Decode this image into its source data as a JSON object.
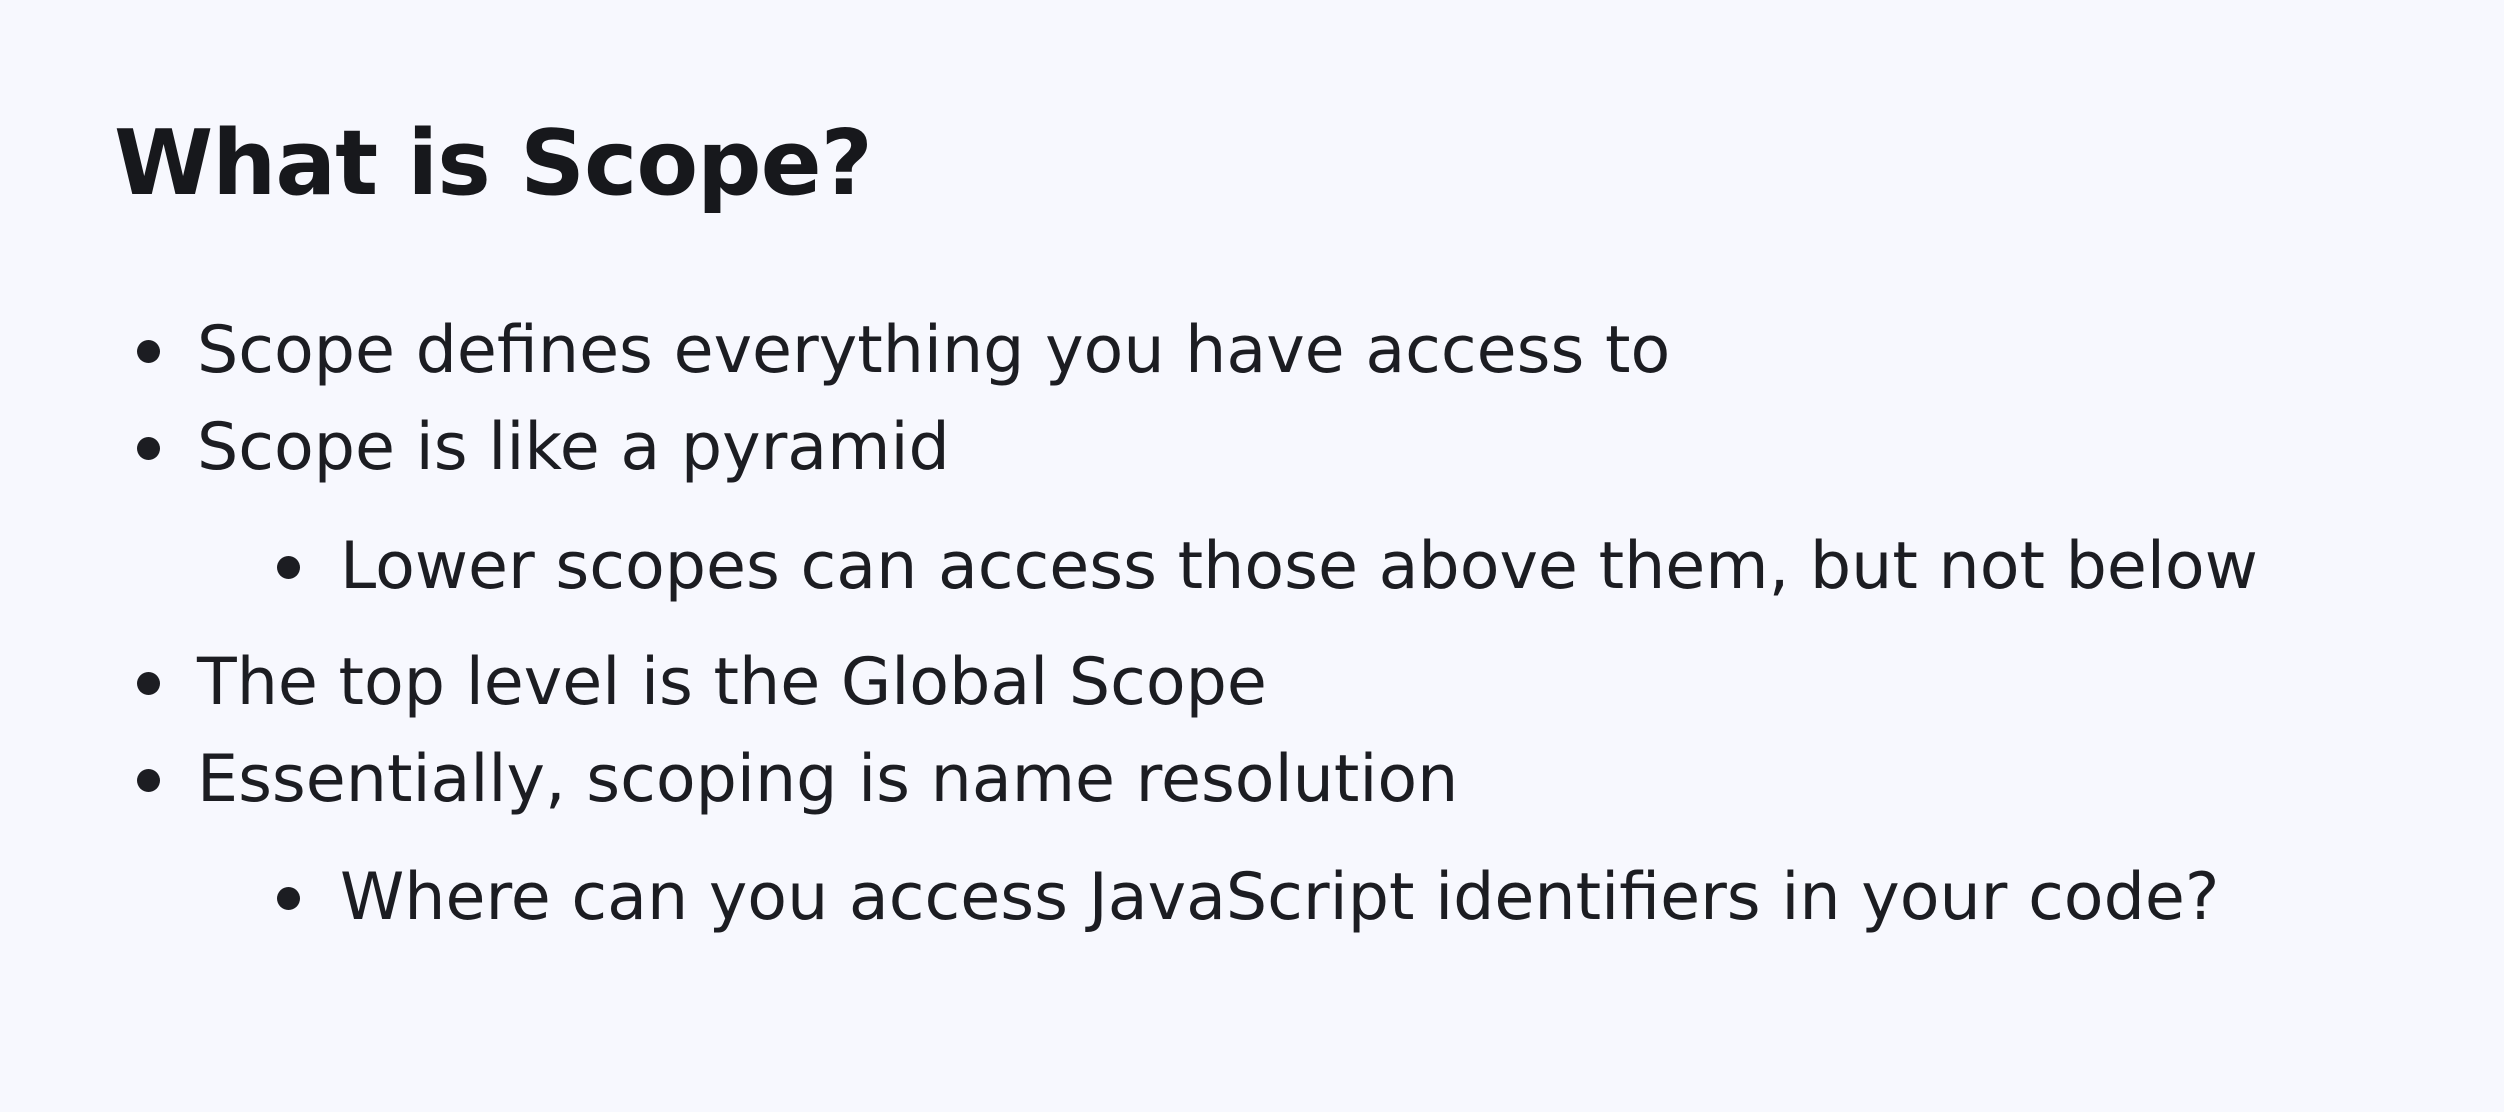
{
  "slide": {
    "title": "What is Scope?",
    "bullets": [
      {
        "level": 1,
        "text": "Scope defines everything you have access to"
      },
      {
        "level": 1,
        "text": "Scope is like a pyramid"
      },
      {
        "level": 2,
        "text": "Lower scopes can access those above them, but not below"
      },
      {
        "level": 1,
        "text": "The top level is the Global Scope"
      },
      {
        "level": 1,
        "text": "Essentially, scoping is name resolution"
      },
      {
        "level": 2,
        "text": "Where can you access JavaScript identifiers in your code?"
      }
    ]
  },
  "colors": {
    "background": "#f7f8fe",
    "text": "#1c1d22"
  },
  "icons": {
    "bullet": "bullet-dot-icon"
  }
}
